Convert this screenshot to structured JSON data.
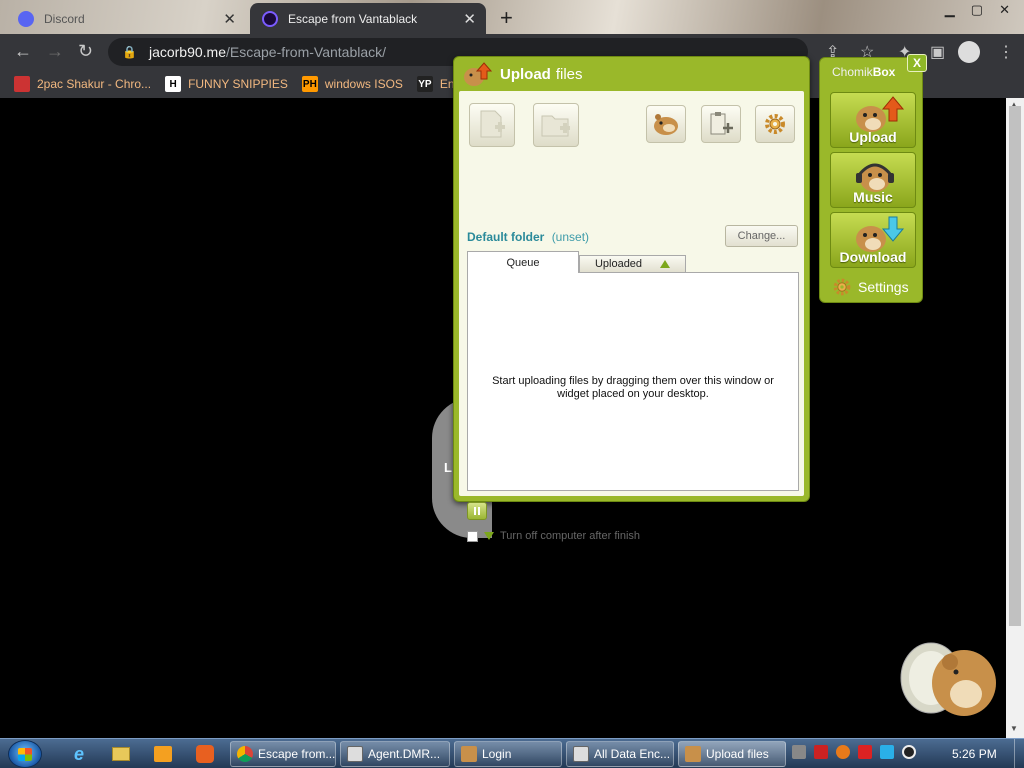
{
  "browser": {
    "tabs": [
      {
        "title": "Discord"
      },
      {
        "title": "Escape from Vantablack"
      }
    ],
    "url_host": "jacorb90.me",
    "url_path": "/Escape-from-Vantablack/",
    "bookmarks": [
      {
        "label": "2pac Shakur - Chro...",
        "icon": "H"
      },
      {
        "label": "FUNNY SNIPPIES",
        "icon": "H"
      },
      {
        "label": "windows ISOS",
        "icon": "PH"
      },
      {
        "label": "End",
        "icon": "YP"
      }
    ],
    "page_letter": "L"
  },
  "upload_window": {
    "title_bold": "Upload",
    "title_rest": "files",
    "default_folder_label": "Default folder",
    "default_folder_value": "(unset)",
    "change_button": "Change...",
    "tabs": {
      "queue": "Queue",
      "uploaded": "Uploaded"
    },
    "queue_message": "Start uploading files by dragging them over this window or widget placed on your desktop.",
    "turn_off_label": "Turn off computer after finish",
    "accent_color": "#9ab82a"
  },
  "chomikbox": {
    "title_prefix": "Chomik",
    "title_suffix": "Box",
    "close": "X",
    "buttons": [
      {
        "label": "Upload",
        "icon": "upload-arrow-icon"
      },
      {
        "label": "Music",
        "icon": "headphones-icon"
      },
      {
        "label": "Download",
        "icon": "download-arrow-icon"
      }
    ],
    "settings_label": "Settings"
  },
  "taskbar": {
    "items": [
      {
        "label": "Escape from..."
      },
      {
        "label": "Agent.DMR..."
      },
      {
        "label": "Login"
      },
      {
        "label": "All Data Enc..."
      },
      {
        "label": "Upload files"
      }
    ],
    "clock": "5:26 PM"
  }
}
